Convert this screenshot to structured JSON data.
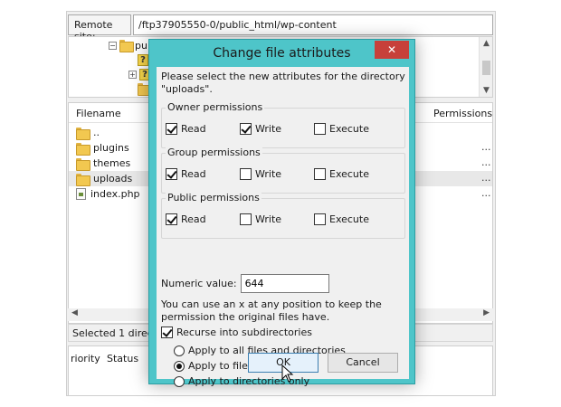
{
  "remote": {
    "label": "Remote site:",
    "path": "/ftp37905550-0/public_html/wp-content",
    "tree_partial_label": "publ"
  },
  "file_list": {
    "columns": {
      "filename": "Filename",
      "permissions": "Permissions"
    },
    "rows": [
      {
        "name": "..",
        "icon": "folder-icon"
      },
      {
        "name": "plugins",
        "icon": "folder-icon"
      },
      {
        "name": "themes",
        "icon": "folder-icon"
      },
      {
        "name": "uploads",
        "icon": "folder-icon",
        "selected": true
      },
      {
        "name": "index.php",
        "icon": "php-file-icon"
      }
    ],
    "truncation": "..."
  },
  "status_bar": {
    "text": "Selected 1 directo"
  },
  "queue": {
    "columns": {
      "priority": "riority",
      "status": "Status"
    }
  },
  "dialog": {
    "title": "Change file attributes",
    "close_symbol": "✕",
    "intro": "Please select the new attributes for the directory \"uploads\".",
    "groups": {
      "owner": {
        "label": "Owner permissions",
        "read": "Read",
        "write": "Write",
        "execute": "Execute"
      },
      "group": {
        "label": "Group permissions",
        "read": "Read",
        "write": "Write",
        "execute": "Execute"
      },
      "public": {
        "label": "Public permissions",
        "read": "Read",
        "write": "Write",
        "execute": "Execute"
      }
    },
    "numeric_label": "Numeric value:",
    "numeric_value": "644",
    "hint": "You can use an x at any position to keep the permission the original files have.",
    "recurse_label": "Recurse into subdirectories",
    "apply_options": {
      "all": "Apply to all files and directories",
      "files": "Apply to files only",
      "dirs": "Apply to directories only"
    },
    "ok_label": "OK",
    "cancel_label": "Cancel"
  },
  "colors": {
    "dialog_frame": "#4ec5c9",
    "close_button": "#c7403a",
    "default_button_border": "#3c7fb1",
    "folder": "#f2c850"
  }
}
